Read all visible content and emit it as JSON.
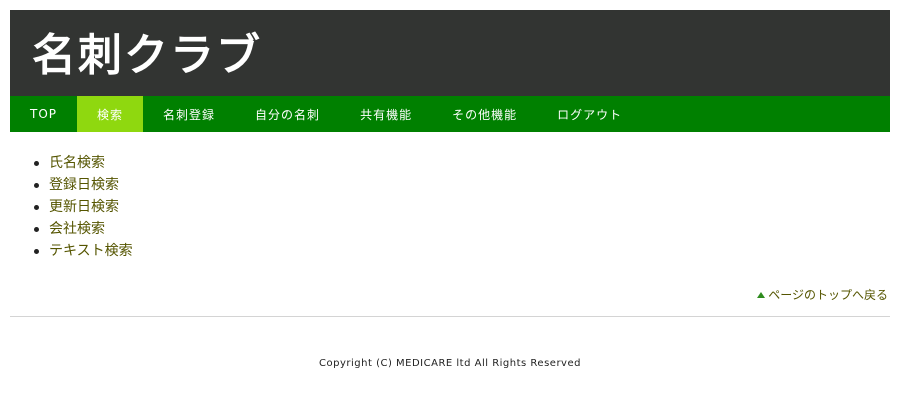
{
  "header": {
    "site_title": "名刺クラブ"
  },
  "nav": {
    "items": [
      {
        "label": "TOP"
      },
      {
        "label": "検索"
      },
      {
        "label": "名刺登録"
      },
      {
        "label": "自分の名刺"
      },
      {
        "label": "共有機能"
      },
      {
        "label": "その他機能"
      },
      {
        "label": "ログアウト"
      }
    ],
    "active_label": "検索"
  },
  "search_menu": {
    "items": [
      {
        "label": "氏名検索"
      },
      {
        "label": "登録日検索"
      },
      {
        "label": "更新日検索"
      },
      {
        "label": "会社検索"
      },
      {
        "label": "テキスト検索"
      }
    ]
  },
  "back_to_top": {
    "label": "ページのトップへ戻る",
    "icon": "triangle-up-icon"
  },
  "footer": {
    "copyright": "Copyright (C) MEDICARE ltd All Rights Reserved"
  },
  "colors": {
    "header_bg": "#323432",
    "nav_bg": "#008000",
    "nav_active_bg": "#8fd80f",
    "link": "#555500"
  }
}
